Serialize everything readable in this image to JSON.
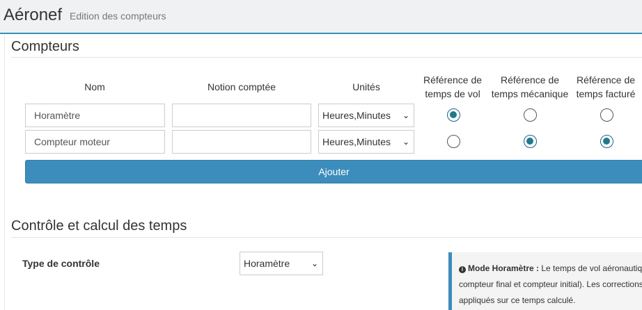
{
  "header": {
    "title": "Aéronef",
    "subtitle": "Edition des compteurs"
  },
  "compteurs": {
    "section_title": "Compteurs",
    "columns": {
      "nom": "Nom",
      "notion": "Notion comptée",
      "unites": "Unités",
      "ref_vol_1": "Référence de",
      "ref_vol_2": "temps de vol",
      "ref_meca_1": "Référence de",
      "ref_meca_2": "temps mécanique",
      "ref_fact_1": "Référence de",
      "ref_fact_2": "temps facturé"
    },
    "rows": [
      {
        "nom": "Horamètre",
        "notion": "",
        "unites": "Heures,Minutes",
        "ref_vol": true,
        "ref_meca": false,
        "ref_fact": false
      },
      {
        "nom": "Compteur moteur",
        "notion": "",
        "unites": "Heures,Minutes",
        "ref_vol": false,
        "ref_meca": true,
        "ref_fact": true
      }
    ],
    "add_button": "Ajouter"
  },
  "controle": {
    "section_title": "Contrôle et calcul des temps",
    "type_label": "Type de contrôle",
    "type_value": "Horamètre",
    "info": {
      "icon": "info-circle-icon",
      "title": "Mode Horamètre :",
      "line1": "Le temps de vol aéronautiqu",
      "line2": "compteur final et compteur initial). Les corrections",
      "line3": "appliqués sur ce temps calculé."
    }
  },
  "colors": {
    "accent": "#3c8dbc",
    "header_bg": "#f0f1f3"
  }
}
